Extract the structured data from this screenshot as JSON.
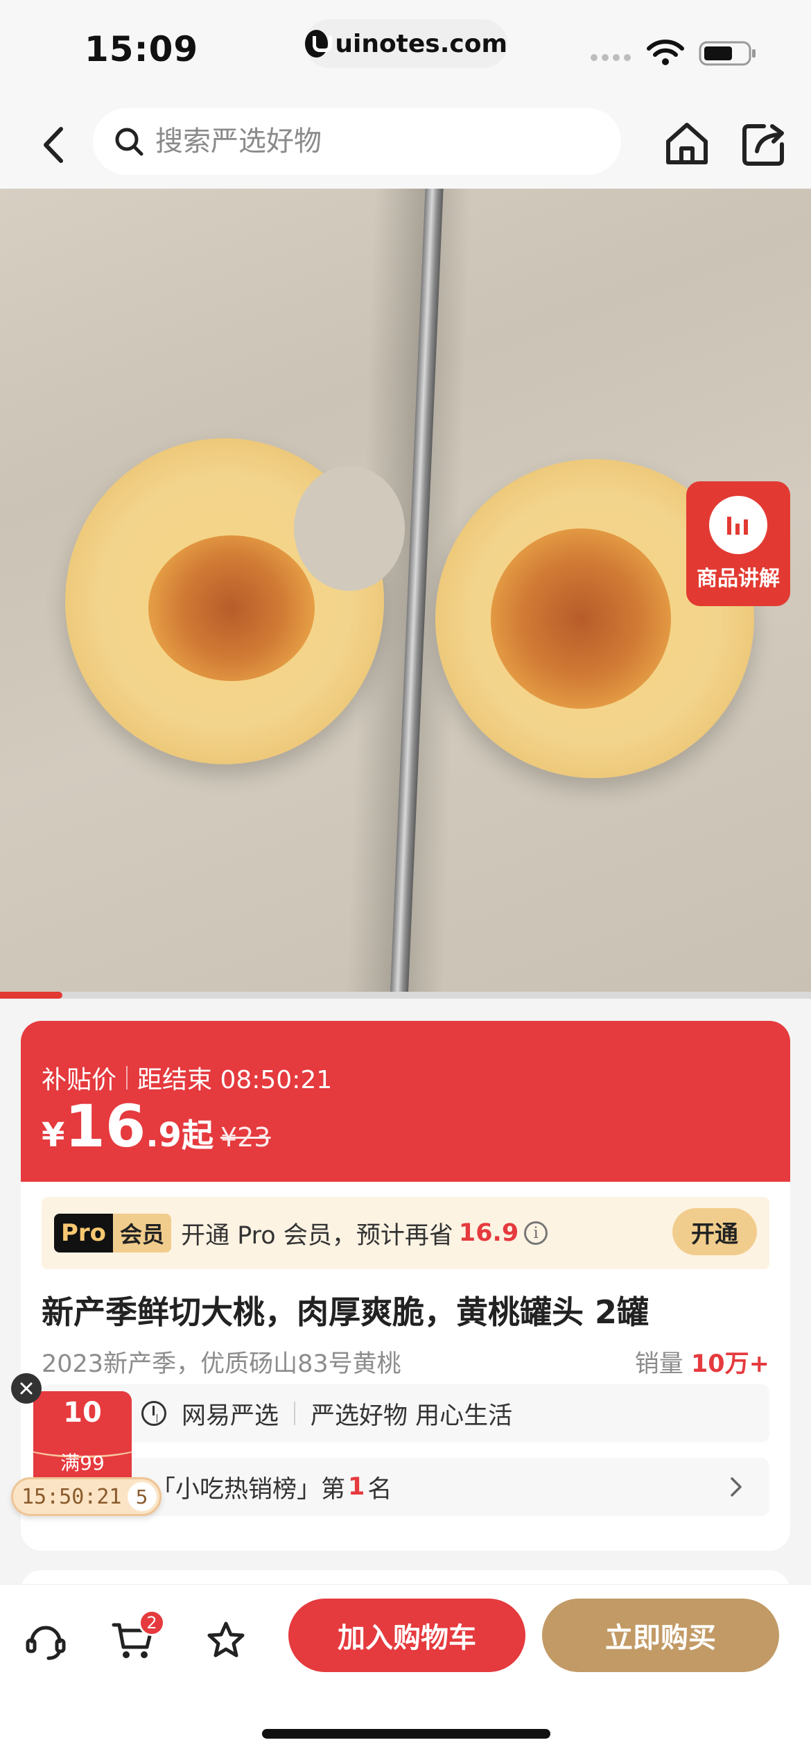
{
  "status_bar": {
    "time": "15:09",
    "url": "uinotes.com"
  },
  "nav": {
    "search_placeholder": "搜索严选好物"
  },
  "media": {
    "explain_label": "商品讲解",
    "video_progress": 0.077
  },
  "price_banner": {
    "promo_label": "补贴价",
    "countdown": "距结束 08:50:21",
    "currency": "¥",
    "price_int": "16",
    "price_dec": ".9",
    "price_suffix": "起",
    "original_price": "¥23"
  },
  "pro": {
    "badge_a": "Pro",
    "badge_b": "会员",
    "text": "开通 Pro 会员，预计再省",
    "save": "16.9",
    "info": "i",
    "button": "开通"
  },
  "product": {
    "title": "新产季鲜切大桃，肉厚爽脆，黄桃罐头 2罐",
    "subtitle": "2023新产季，优质砀山83号黄桃",
    "sales_label": "销量",
    "sales_value": "10万+"
  },
  "brand_row": {
    "brand": "网易严选",
    "slogan": "严选好物 用心生活"
  },
  "rank_row": {
    "prefix": "「小吃热销榜」第",
    "rank": "1",
    "suffix": "名"
  },
  "coupon": {
    "amount": "10",
    "condition": "满99",
    "timer": "15:50:21",
    "timer_ms": "5"
  },
  "bottom_bar": {
    "cart_count": "2",
    "add_to_cart": "加入购物车",
    "buy_now": "立即购买"
  },
  "colors": {
    "accent_red": "#e53a3e",
    "gold": "#c29a66",
    "pro_gold": "#f1cd8d"
  }
}
